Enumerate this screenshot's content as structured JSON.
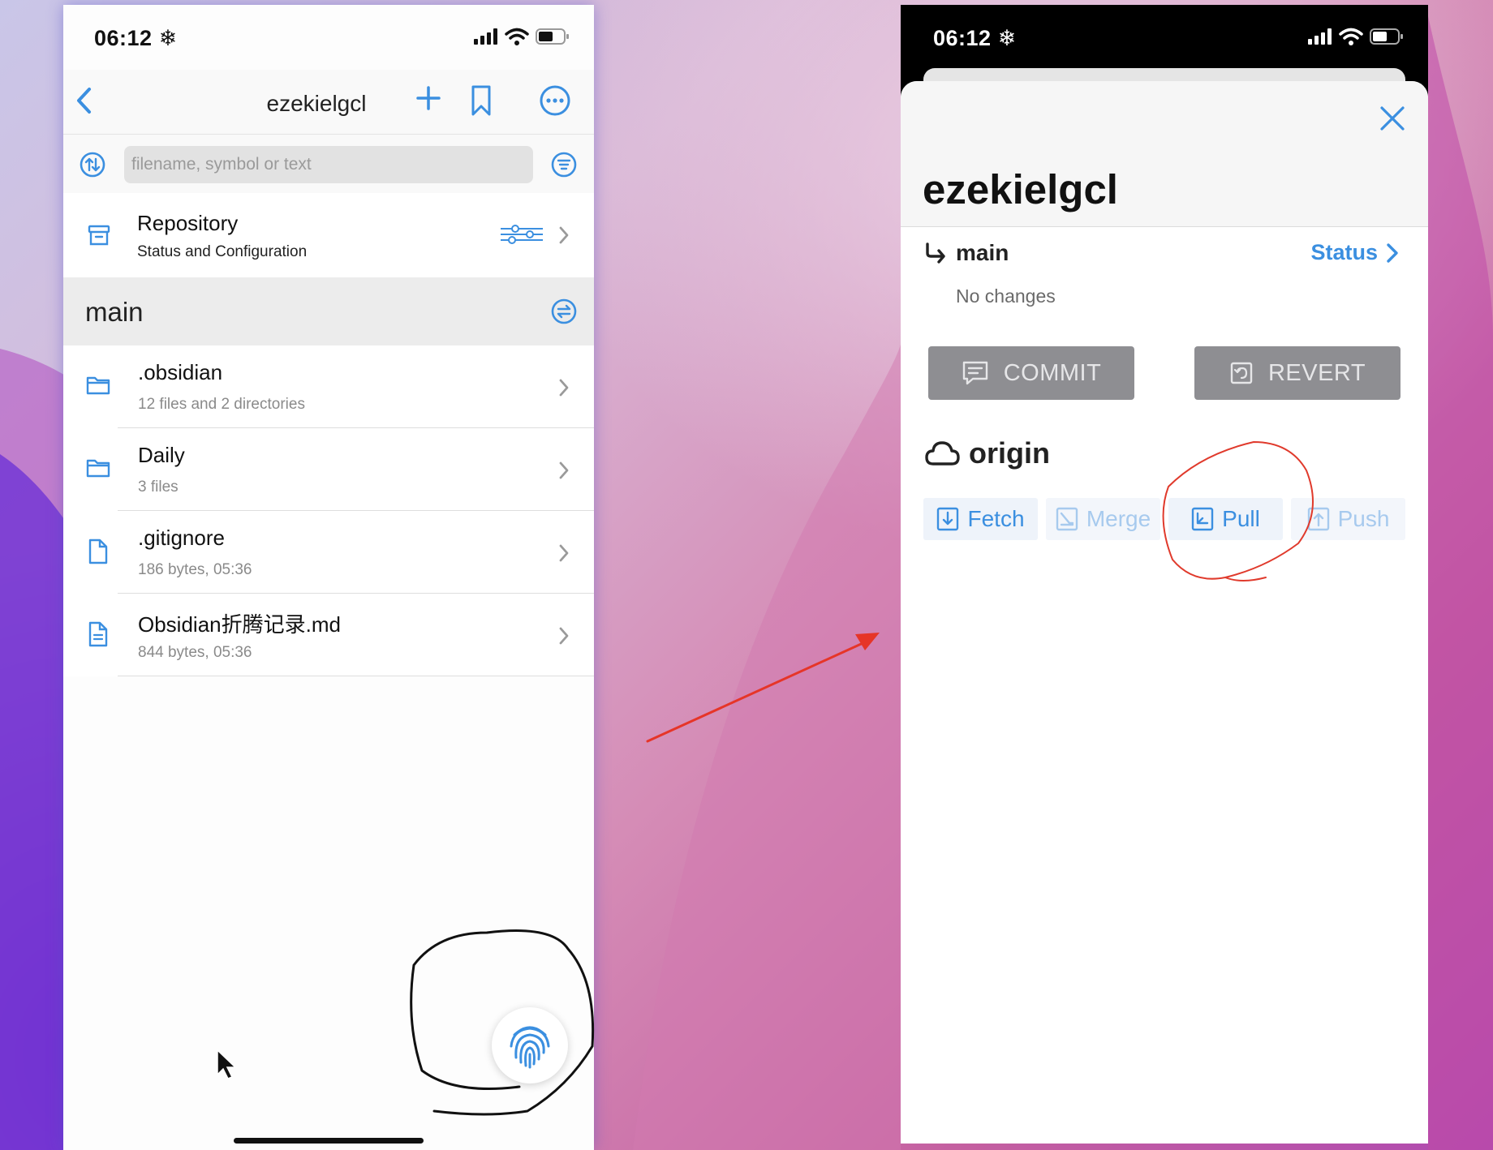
{
  "left": {
    "status": {
      "time": "06:12"
    },
    "nav": {
      "title": "ezekielgcl"
    },
    "search": {
      "placeholder": "filename, symbol or text"
    },
    "repository": {
      "title": "Repository",
      "subtitle": "Status and Configuration"
    },
    "branch": {
      "name": "main"
    },
    "files": [
      {
        "name": ".obsidian",
        "meta": "12 files and 2 directories",
        "icon": "folder-icon"
      },
      {
        "name": "Daily",
        "meta": "3 files",
        "icon": "folder-icon"
      },
      {
        "name": ".gitignore",
        "meta": "186 bytes, 05:36",
        "icon": "file-icon"
      },
      {
        "name": "Obsidian折腾记录.md",
        "meta": "844 bytes, 05:36",
        "icon": "document-icon"
      }
    ]
  },
  "right": {
    "status": {
      "time": "06:12"
    },
    "title": "ezekielgcl",
    "branch": {
      "name": "main",
      "status_label": "Status",
      "state": "No changes"
    },
    "actions": {
      "commit": "COMMIT",
      "revert": "REVERT"
    },
    "remote": {
      "name": "origin",
      "buttons": [
        {
          "label": "Fetch",
          "enabled": true
        },
        {
          "label": "Merge",
          "enabled": false
        },
        {
          "label": "Pull",
          "enabled": true
        },
        {
          "label": "Push",
          "enabled": false
        }
      ]
    }
  },
  "colors": {
    "accent": "#3b8fe0",
    "annotation_red": "#e03a2c",
    "annotation_black": "#111111"
  }
}
